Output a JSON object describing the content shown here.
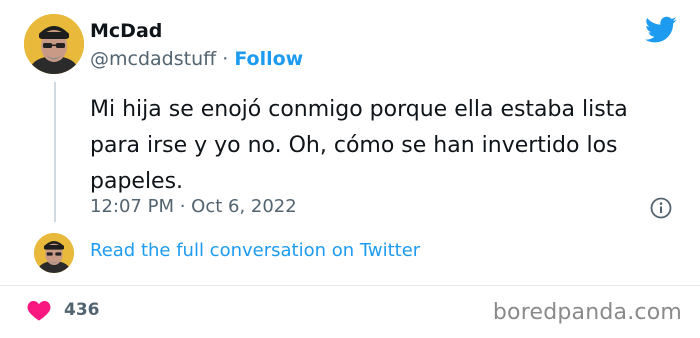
{
  "author": {
    "name": "McDad",
    "handle": "@mcdadstuff",
    "separator": "·",
    "follow_label": "Follow"
  },
  "tweet": {
    "text_lines": [
      "Mi hija se enojó conmigo porque ella estaba lista",
      "para irse y yo no. Oh, cómo se han invertido los",
      "papeles."
    ],
    "timestamp": "12:07 PM · Oct 6, 2022"
  },
  "thread": {
    "read_more_label": "Read the full conversation on Twitter"
  },
  "engagement": {
    "likes": "436"
  },
  "watermark": "boredpanda.com",
  "icons": {
    "brand": "twitter-bird-icon",
    "info": "info-icon",
    "like": "heart-icon"
  },
  "colors": {
    "accent": "#1d9bf0",
    "heart": "#f91880",
    "avatar_bg": "#e8b93a",
    "muted": "#536471"
  }
}
